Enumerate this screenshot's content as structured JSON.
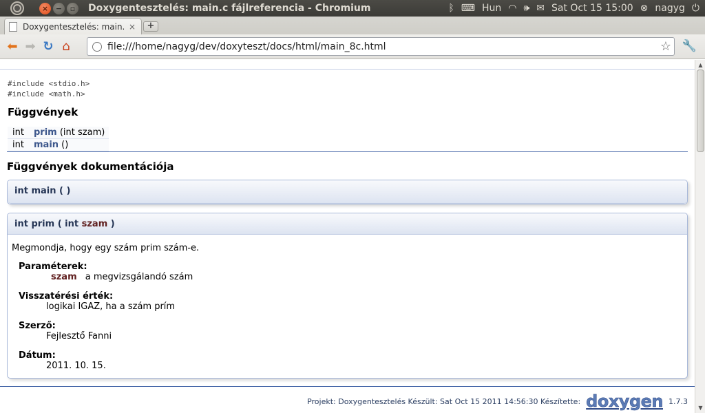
{
  "window": {
    "title": "Doxygentesztelés: main.c fájlreferencia - Chromium",
    "tray": {
      "keyboard_layout": "Hun",
      "datetime": "Sat Oct 15 15:00",
      "user": "nagyg"
    }
  },
  "tabs": [
    {
      "label": "Doxygentesztelés: main.c",
      "close": "×"
    }
  ],
  "newtab_label": "+",
  "toolbar": {
    "url": "file:///home/nagyg/dev/doxyteszt/docs/html/main_8c.html"
  },
  "content": {
    "includes": [
      "#include <stdio.h>",
      "#include <math.h>"
    ],
    "functions_heading": "Függvények",
    "functions": [
      {
        "ret": "int",
        "name": "prim",
        "args": "(int szam)"
      },
      {
        "ret": "int",
        "name": "main",
        "args": "()"
      }
    ],
    "docs_heading": "Függvények dokumentációja",
    "main_proto": "int main (  )",
    "prim": {
      "proto_start": "int prim ( int",
      "proto_param": "szam",
      "proto_end": ")",
      "brief": "Megmondja, hogy egy szám prim szám-e.",
      "params_title": "Paraméterek:",
      "param_name": "szam",
      "param_desc": "a megvizsgálandó szám",
      "return_title": "Visszatérési érték:",
      "return_desc": "logikai IGAZ, ha a szám prím",
      "author_title": "Szerző:",
      "author": "Fejlesztő Fanni",
      "date_title": "Dátum:",
      "date": "2011. 10. 15."
    },
    "footer": {
      "text": "Projekt: Doxygentesztelés Készült: Sat Oct 15 2011 14:56:30 Készítette:",
      "logo": "doxygen",
      "version": "1.7.3"
    }
  }
}
